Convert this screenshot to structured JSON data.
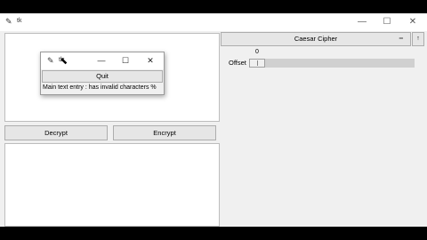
{
  "main_window": {
    "title": "tk",
    "controls": {
      "minimize": "—",
      "maximize": "☐",
      "close": "✕"
    }
  },
  "buttons": {
    "decrypt": "Decrypt",
    "encrypt": "Encrypt"
  },
  "cipher_menu": {
    "selected": "Caesar Cipher",
    "indicator": "═",
    "side_button": "↑"
  },
  "offset": {
    "label": "Offset",
    "value": "0",
    "slider_fraction": 0.0
  },
  "popup": {
    "title": "tk",
    "controls": {
      "minimize": "—",
      "maximize": "☐",
      "close": "✕"
    },
    "quit_label": "Quit",
    "message": "Main text entry : has invalid characters %"
  }
}
